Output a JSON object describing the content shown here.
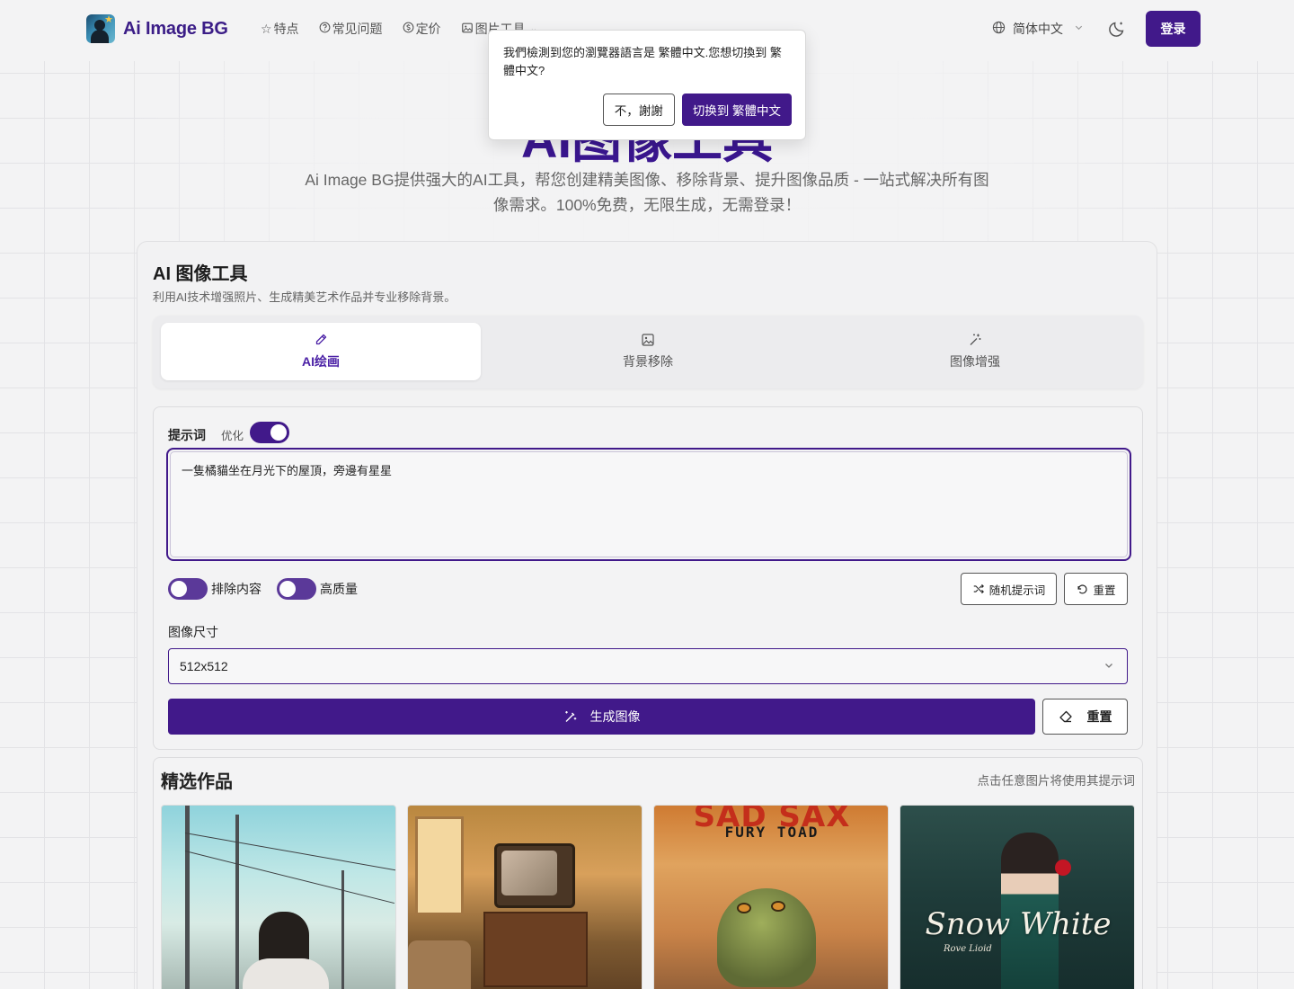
{
  "brand": {
    "name": "Ai Image BG"
  },
  "nav": {
    "items": [
      {
        "icon": "star-icon",
        "label": "特点"
      },
      {
        "icon": "question-circle-icon",
        "label": "常见问题"
      },
      {
        "icon": "dollar-circle-icon",
        "label": "定价"
      },
      {
        "icon": "image-icon",
        "label": "图片工具"
      }
    ]
  },
  "header": {
    "language_label": "简体中文",
    "login_label": "登录"
  },
  "hero": {
    "title": "AI图像工具",
    "subtitle": "Ai Image BG提供强大的AI工具，帮您创建精美图像、移除背景、提升图像品质 - 一站式解决所有图像需求。100%免费，无限生成，无需登录！"
  },
  "language_popup": {
    "message": "我們檢測到您的瀏覽器語言是 繁體中文.您想切換到 繁體中文?",
    "decline_label": "不，謝謝",
    "accept_label": "切换到 繁體中文"
  },
  "tool_card": {
    "title": "AI 图像工具",
    "description": "利用AI技术增强照片、生成精美艺术作品并专业移除背景。",
    "tabs": [
      {
        "label": "AI绘画",
        "icon": "pencil-icon",
        "active": true
      },
      {
        "label": "背景移除",
        "icon": "image-icon",
        "active": false
      },
      {
        "label": "图像增强",
        "icon": "magic-wand-icon",
        "active": false
      }
    ]
  },
  "form": {
    "prompt_label": "提示词",
    "optimize_label": "优化",
    "optimize_on": true,
    "prompt_value": "一隻橘貓坐在月光下的屋頂，旁邊有星星",
    "exclude_label": "排除内容",
    "exclude_on": false,
    "hq_label": "高质量",
    "hq_on": false,
    "random_prompt_label": "随机提示词",
    "reset_label": "重置",
    "size_label": "图像尺寸",
    "size_value": "512x512",
    "generate_label": "生成图像",
    "reset2_label": "重置"
  },
  "gallery": {
    "title": "精选作品",
    "hint": "点击任意图片将使用其提示词",
    "items": [
      {
        "name": "street-girl"
      },
      {
        "name": "retro-tv-room"
      },
      {
        "name": "frog-poster",
        "text_line1": "SAD SAX",
        "text_line2": "FURY TOAD"
      },
      {
        "name": "snow-white-poster",
        "text_line1": "Snow White",
        "text_line2": "Rove Lioid"
      }
    ]
  },
  "colors": {
    "brand": "#41198a",
    "title": "#3a168f",
    "background": "#f3f3f4"
  }
}
